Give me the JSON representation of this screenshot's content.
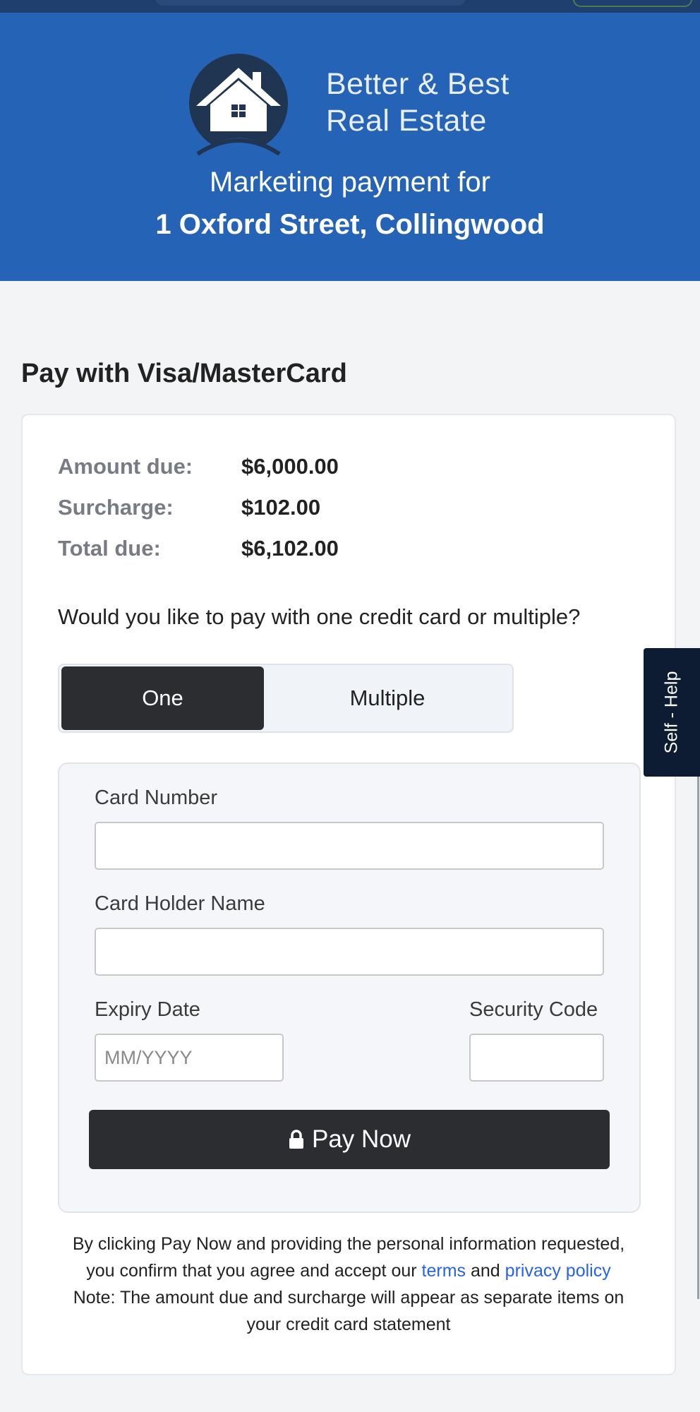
{
  "header": {
    "brand_line1": "Better & Best",
    "brand_line2": "Real Estate",
    "subtitle": "Marketing payment for",
    "address": "1 Oxford Street, Collingwood",
    "bg_color": "#2563b6"
  },
  "section_title": "Pay with Visa/MasterCard",
  "summary": [
    {
      "label": "Amount due:",
      "value": "$6,000.00"
    },
    {
      "label": "Surcharge:",
      "value": "$102.00"
    },
    {
      "label": "Total due:",
      "value": "$6,102.00"
    }
  ],
  "question": "Would you like to pay with one credit card or multiple?",
  "toggle": {
    "one": "One",
    "multiple": "Multiple",
    "selected": "One"
  },
  "form": {
    "card_number_label": "Card Number",
    "card_holder_label": "Card Holder Name",
    "expiry_label": "Expiry Date",
    "expiry_placeholder": "MM/YYYY",
    "security_label": "Security Code",
    "pay_button": "Pay Now",
    "pay_icon": "lock-icon"
  },
  "legal": {
    "line1": "By clicking Pay Now and providing the personal information requested,",
    "line2_pre": "you confirm that you agree and accept our",
    "terms": "terms",
    "and": "and",
    "privacy": "privacy policy",
    "note1": "Note: The amount due and surcharge will appear as separate items on",
    "note2": "your credit card statement"
  },
  "help_tab": "Self - Help"
}
